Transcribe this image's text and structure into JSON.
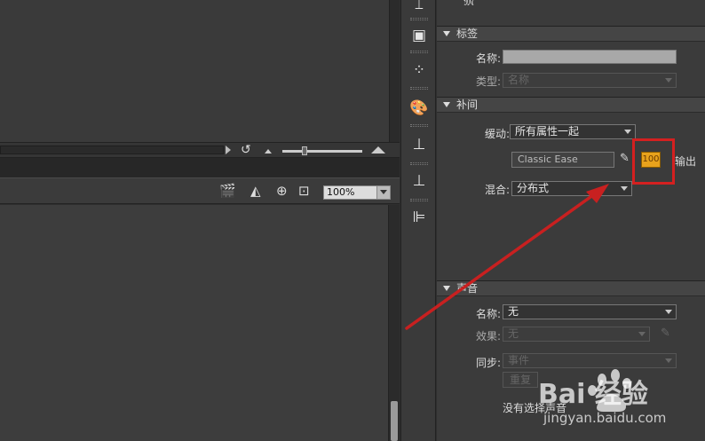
{
  "timeline": {
    "loop_icon": "loop-arrow-icon",
    "zoom_value": "100%"
  },
  "properties": {
    "label_section": {
      "title": "标签",
      "name_label": "名称:",
      "type_label": "类型:",
      "type_value": "名称"
    },
    "tween_section": {
      "title": "补间",
      "ease_label": "缓动:",
      "ease_value": "所有属性一起",
      "ease_preset": "Classic Ease",
      "ease_amount": "100",
      "ease_direction": "输出",
      "blend_label": "混合:",
      "blend_value": "分布式"
    },
    "sound_section": {
      "title": "声音",
      "name_label": "名称:",
      "name_value": "无",
      "effect_label": "效果:",
      "effect_value": "无",
      "sync_label": "同步:",
      "sync_value": "事件",
      "repeat_value": "重复",
      "no_sound_text": "没有选择声音"
    }
  },
  "watermark": {
    "brand": "Bai  经验",
    "url": "jingyan.baidu.com"
  },
  "colors": {
    "highlight": "#d42020",
    "ease_badge": "#e8a21c"
  }
}
